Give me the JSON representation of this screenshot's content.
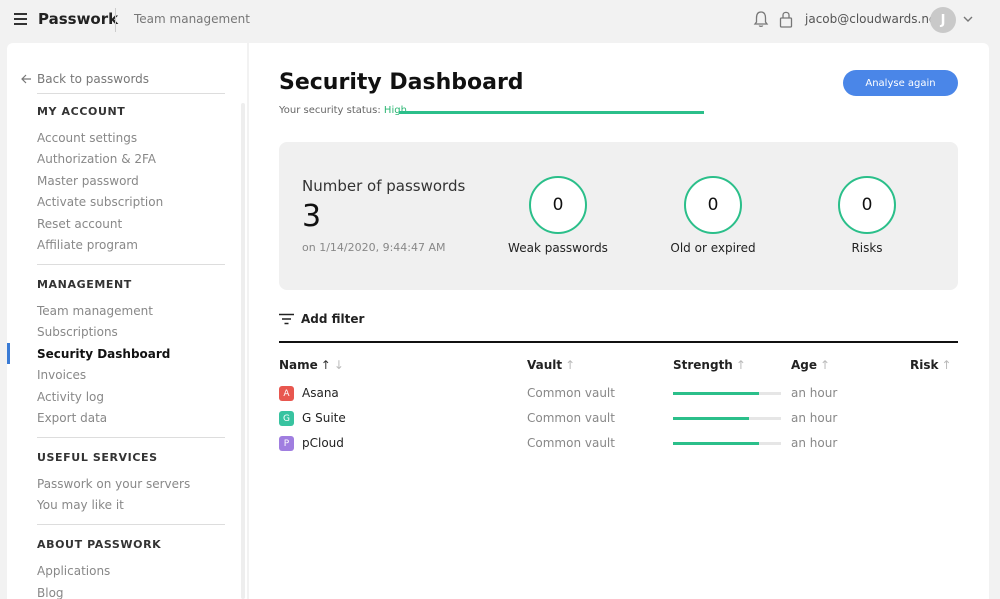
{
  "header": {
    "brand": "Passwork",
    "breadcrumb": "Team management",
    "user_email": "jacob@cloudwards.net",
    "avatar_initial": "J"
  },
  "sidebar": {
    "back_label": "Back to passwords",
    "sections": [
      {
        "title": "MY ACCOUNT",
        "items": [
          "Account settings",
          "Authorization & 2FA",
          "Master password",
          "Activate subscription",
          "Reset account",
          "Affiliate program"
        ]
      },
      {
        "title": "MANAGEMENT",
        "items": [
          "Team management",
          "Subscriptions",
          "Security Dashboard",
          "Invoices",
          "Activity log",
          "Export data"
        ]
      },
      {
        "title": "USEFUL SERVICES",
        "items": [
          "Passwork on your servers",
          "You may like it"
        ]
      },
      {
        "title": "ABOUT PASSWORK",
        "items": [
          "Applications",
          "Blog"
        ]
      }
    ],
    "active_item": "Security Dashboard"
  },
  "main": {
    "title": "Security Dashboard",
    "analyse_button": "Analyse again",
    "status_label": "Your security status:",
    "status_value": "High",
    "stats": {
      "count_label": "Number of passwords",
      "count_value": "3",
      "date": "on 1/14/2020, 9:44:47 AM",
      "rings": [
        {
          "value": "0",
          "label": "Weak passwords"
        },
        {
          "value": "0",
          "label": "Old or expired"
        },
        {
          "value": "0",
          "label": "Risks"
        }
      ]
    },
    "filter_label": "Add filter",
    "table": {
      "columns": [
        "Name",
        "Vault",
        "Strength",
        "Age",
        "Risk"
      ],
      "rows": [
        {
          "badge": "A",
          "badge_color": "#e8574f",
          "name": "Asana",
          "vault": "Common vault",
          "strength": 0.8,
          "age": "an hour"
        },
        {
          "badge": "G",
          "badge_color": "#38c3a0",
          "name": "G Suite",
          "vault": "Common vault",
          "strength": 0.7,
          "age": "an hour"
        },
        {
          "badge": "P",
          "badge_color": "#a07ee0",
          "name": "pCloud",
          "vault": "Common vault",
          "strength": 0.8,
          "age": "an hour"
        }
      ]
    }
  },
  "colors": {
    "accent": "#4a86e8",
    "success": "#2bbf8a"
  }
}
